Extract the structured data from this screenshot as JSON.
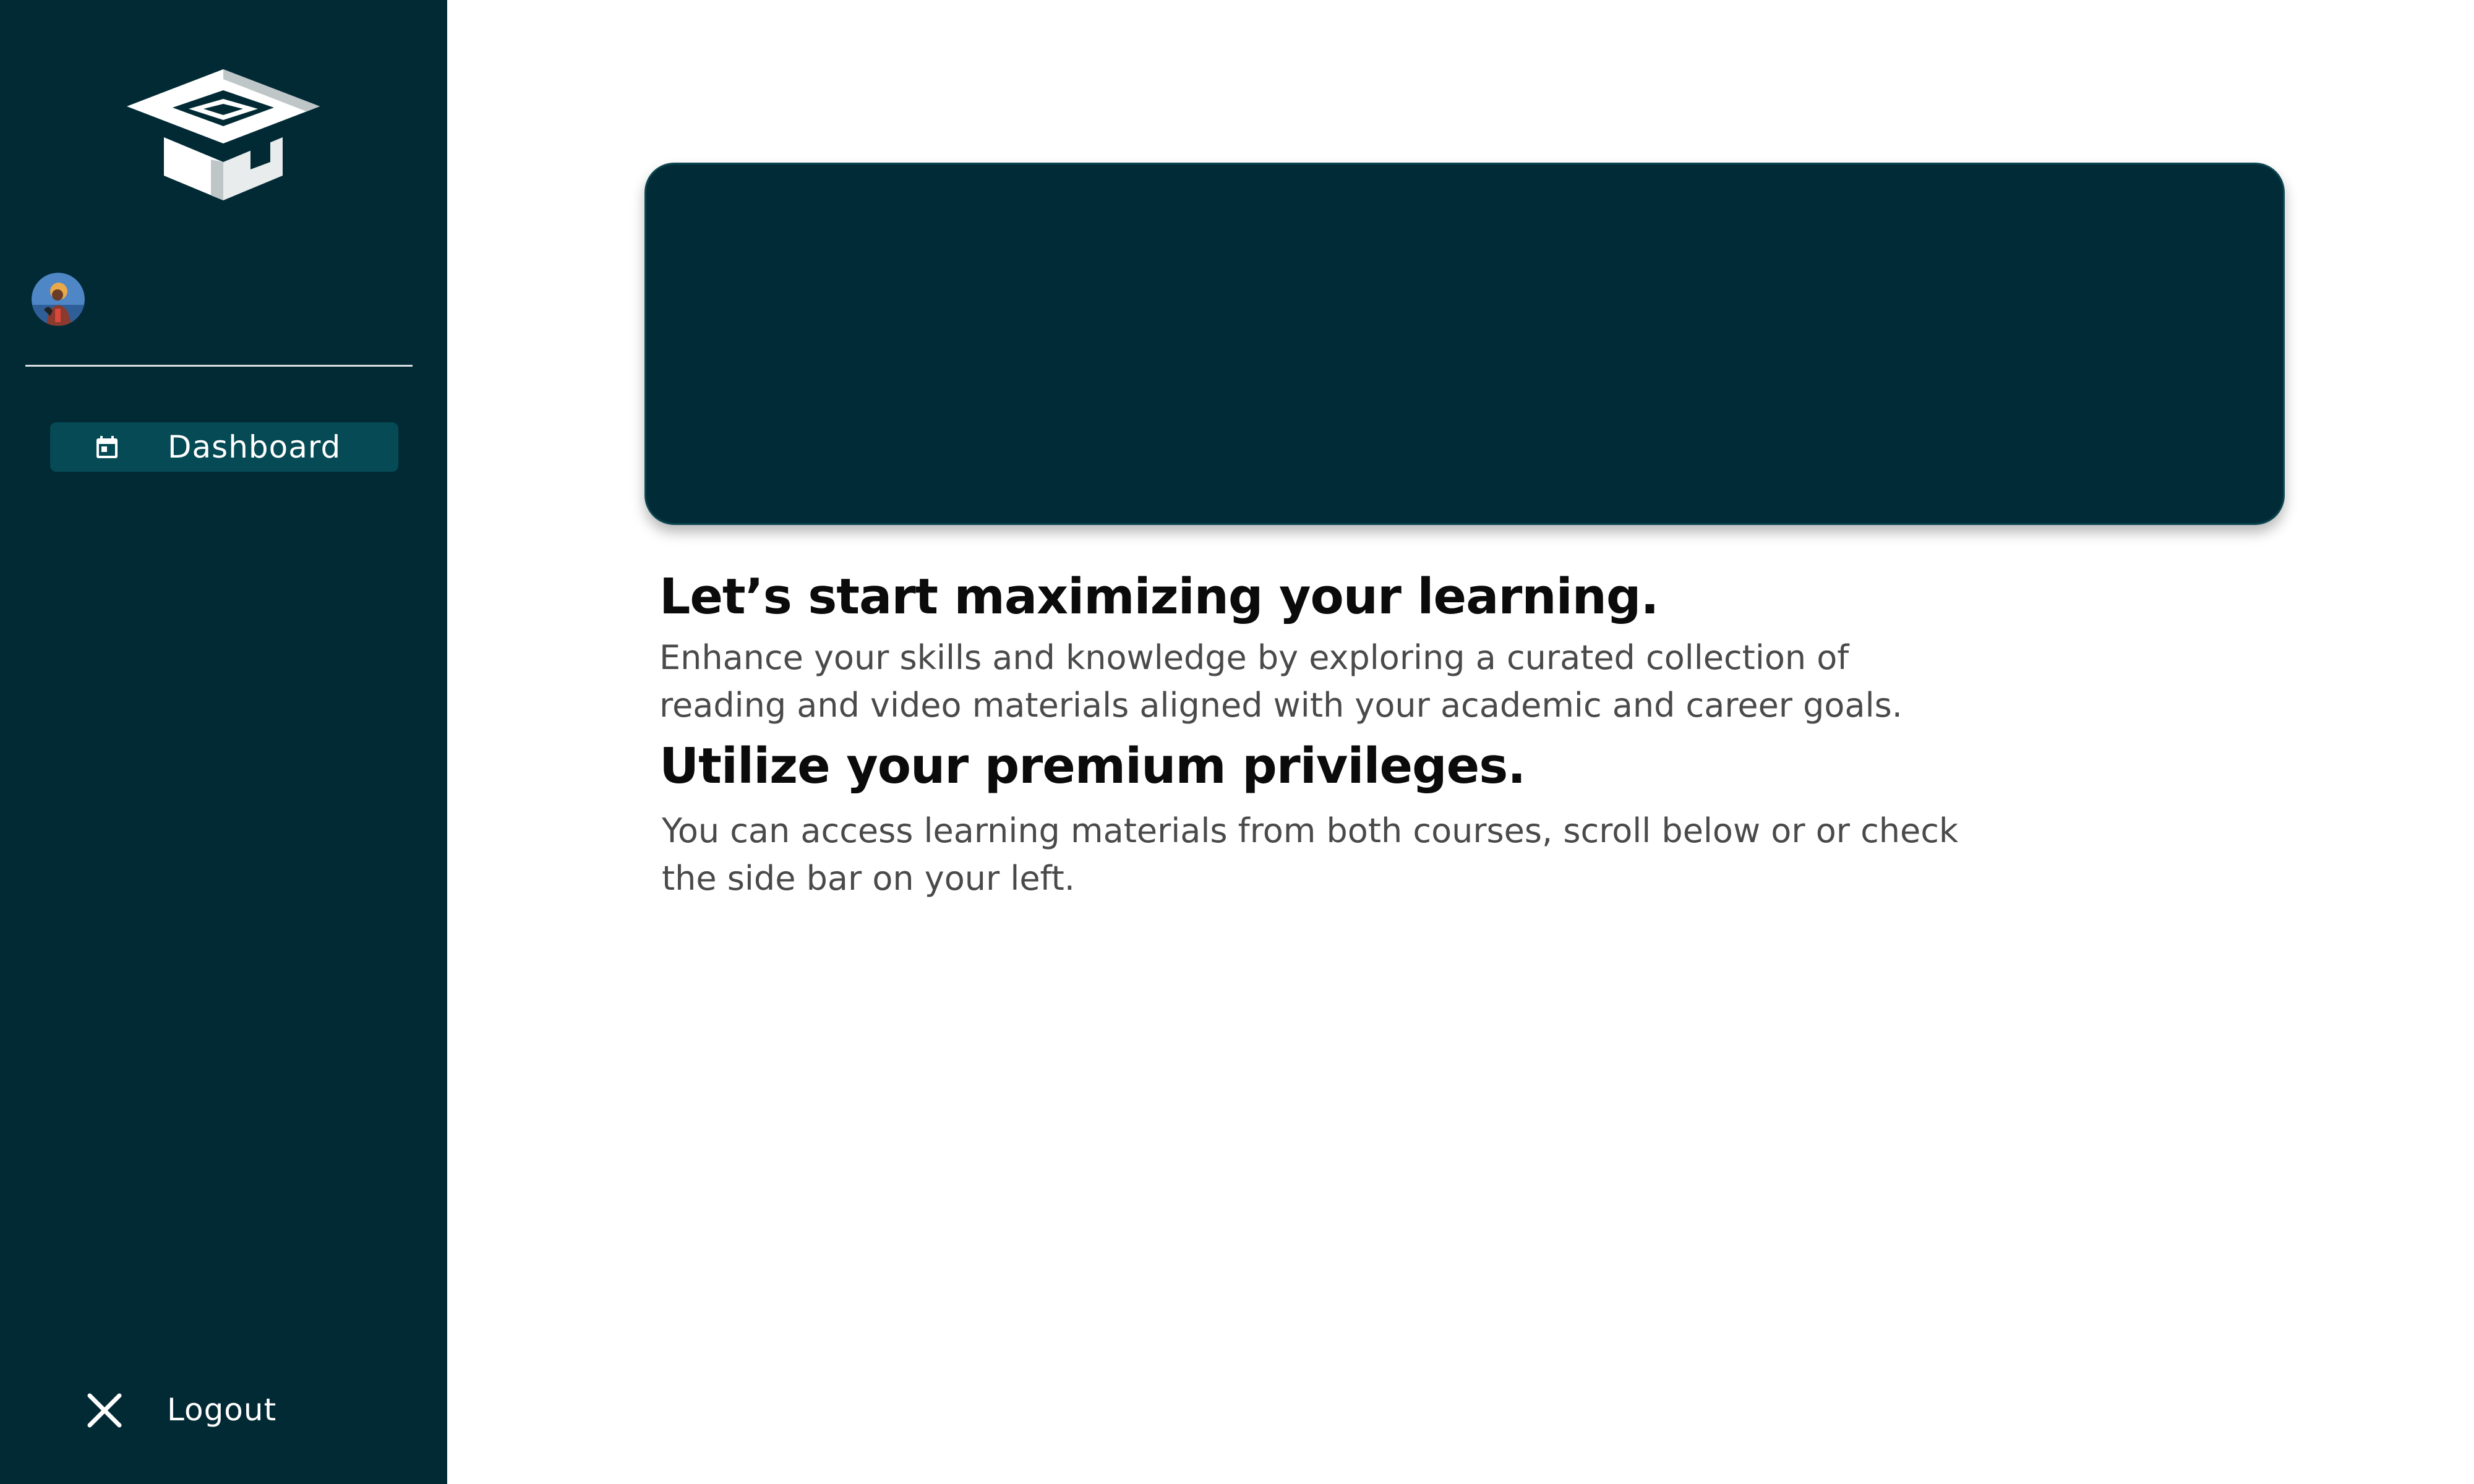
{
  "sidebar": {
    "logo_icon": "graduation-cap-icon",
    "avatar_icon": "user-avatar",
    "nav_items": [
      {
        "label": "Dashboard",
        "icon": "calendar-icon",
        "active": true
      }
    ],
    "logout": {
      "label": "Logout",
      "icon": "close-icon"
    }
  },
  "main": {
    "sections": [
      {
        "heading": "Let’s start maximizing your learning.",
        "text": "Enhance your skills and knowledge by exploring a curated collection of reading and video materials aligned with your academic and career goals."
      },
      {
        "heading": "Utilize your premium privileges.",
        "text": "You can access learning materials from both courses, scroll below or or check the side bar on your left."
      }
    ]
  },
  "colors": {
    "sidebar_bg": "#012a35",
    "nav_active_bg": "#054a54",
    "hero_bg": "#012b37"
  }
}
